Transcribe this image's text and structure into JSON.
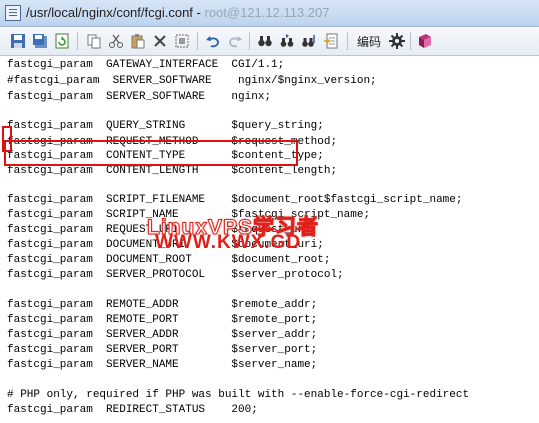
{
  "window": {
    "title": "/usr/local/nginx/conf/fcgi.conf - ",
    "title_suffix": "root@121.12.113.207"
  },
  "toolbar": {
    "encoding_label": "编码",
    "icons": [
      "save-icon",
      "save-all-icon",
      "reload-icon",
      "copy-icon",
      "cut-icon",
      "paste-icon",
      "delete-icon",
      "select-all-icon",
      "undo-icon",
      "redo-icon",
      "find-icon",
      "find-next-icon",
      "replace-icon",
      "goto-icon",
      "encoding-label",
      "settings-icon",
      "bookmark-icon"
    ]
  },
  "editor": {
    "lines": [
      "fastcgi_param  GATEWAY_INTERFACE  CGI/1.1;",
      "#fastcgi_param  SERVER_SOFTWARE    nginx/$nginx_version;",
      "fastcgi_param  SERVER_SOFTWARE    nginx;",
      "",
      "fastcgi_param  QUERY_STRING       $query_string;",
      "fastcgi_param  REQUEST_METHOD     $request_method;",
      "fastcgi_param  CONTENT_TYPE       $content_type;",
      "fastcgi_param  CONTENT_LENGTH     $content_length;",
      "",
      "fastcgi_param  SCRIPT_FILENAME    $document_root$fastcgi_script_name;",
      "fastcgi_param  SCRIPT_NAME        $fastcgi_script_name;",
      "fastcgi_param  REQUEST_URI        $request_uri;",
      "fastcgi_param  DOCUMENT_URI       $document_uri;",
      "fastcgi_param  DOCUMENT_ROOT      $document_root;",
      "fastcgi_param  SERVER_PROTOCOL    $server_protocol;",
      "",
      "fastcgi_param  REMOTE_ADDR        $remote_addr;",
      "fastcgi_param  REMOTE_PORT        $remote_port;",
      "fastcgi_param  SERVER_ADDR        $server_addr;",
      "fastcgi_param  SERVER_PORT        $server_port;",
      "fastcgi_param  SERVER_NAME        $server_name;",
      "",
      "# PHP only, required if PHP was built with --enable-force-cgi-redirect",
      "fastcgi_param  REDIRECT_STATUS    200;"
    ]
  },
  "watermark": {
    "line1": "LinuxVPS学习者",
    "line2": "WWW.KWX.GD"
  },
  "colors": {
    "highlight": "#e01010",
    "watermark": "#e0201a"
  }
}
